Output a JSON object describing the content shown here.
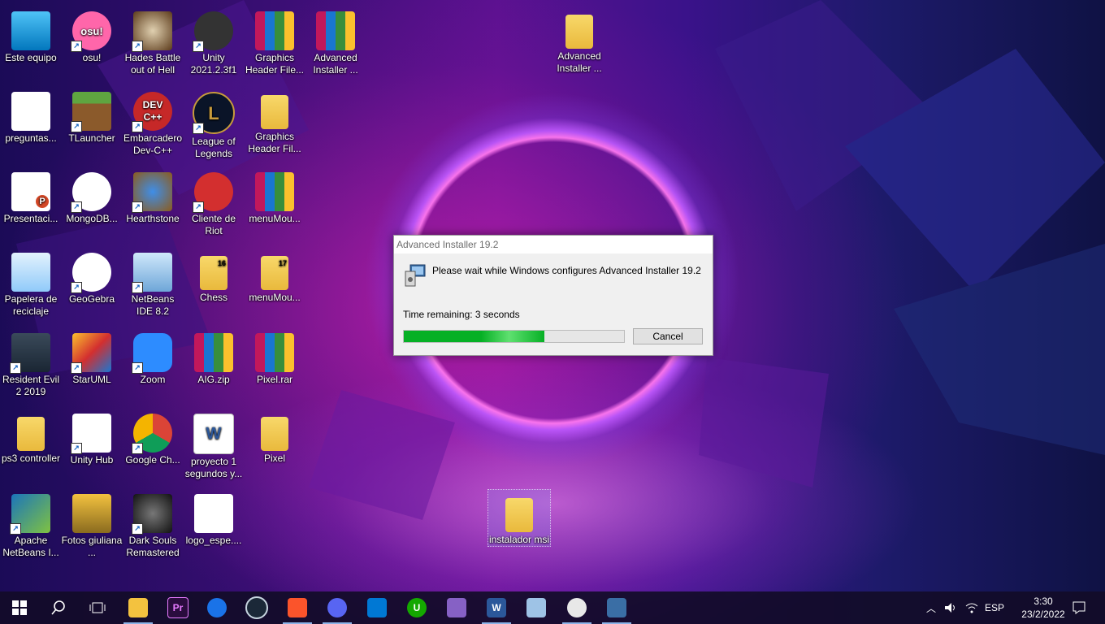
{
  "desktop": {
    "icons": [
      {
        "label": "Este equipo"
      },
      {
        "label": "osu!"
      },
      {
        "label": "Hades Battle out of Hell"
      },
      {
        "label": "Unity 2021.2.3f1"
      },
      {
        "label": "Graphics Header File..."
      },
      {
        "label": "Advanced Installer  ..."
      },
      {
        "label": "Advanced Installer ..."
      },
      {
        "label": "preguntas..."
      },
      {
        "label": "TLauncher"
      },
      {
        "label": "Embarcadero Dev-C++"
      },
      {
        "label": "League of Legends"
      },
      {
        "label": "Graphics Header Fil..."
      },
      {
        "label": "Presentaci..."
      },
      {
        "label": "MongoDB..."
      },
      {
        "label": "Hearthstone"
      },
      {
        "label": "Cliente de Riot"
      },
      {
        "label": "menuMou..."
      },
      {
        "label": "Papelera de reciclaje"
      },
      {
        "label": "GeoGebra"
      },
      {
        "label": "NetBeans IDE 8.2"
      },
      {
        "label": "Chess"
      },
      {
        "label": "menuMou..."
      },
      {
        "label": "Resident Evil 2 2019"
      },
      {
        "label": "StarUML"
      },
      {
        "label": "Zoom"
      },
      {
        "label": "AIG.zip"
      },
      {
        "label": "Pixel.rar"
      },
      {
        "label": "ps3 controller"
      },
      {
        "label": "Unity Hub"
      },
      {
        "label": "Google Ch..."
      },
      {
        "label": "proyecto 1 segundos y..."
      },
      {
        "label": "Pixel"
      },
      {
        "label": "Apache NetBeans I..."
      },
      {
        "label": "Fotos giuliana ..."
      },
      {
        "label": "Dark Souls Remastered"
      },
      {
        "label": "logo_espe...."
      },
      {
        "label": "instalador msi"
      }
    ],
    "glyphs": {
      "osu": "osu!",
      "dev": "DEV C++",
      "lol": "L",
      "p": "P",
      "w": "W",
      "badge16": "16",
      "badge17": "17"
    }
  },
  "dialog": {
    "title": "Advanced Installer 19.2",
    "message": "Please wait while Windows configures Advanced Installer 19.2",
    "time_remaining": "Time remaining: 3 seconds",
    "progress": 0.64,
    "cancel_label": "Cancel"
  },
  "taskbar": {
    "items": [
      "start",
      "search",
      "task-view",
      "file-explorer",
      "premiere",
      "brave-sync",
      "steam",
      "brave",
      "discord",
      "vscode",
      "upwork",
      "visual-studio",
      "word",
      "notes",
      "app",
      "installer"
    ],
    "premiere_label": "Pr",
    "upwork_label": "U",
    "language": "ESP",
    "time": "3:30",
    "date": "23/2/2022"
  },
  "colors": {
    "progress": "#06b025",
    "accent": "#8cb4e8"
  }
}
